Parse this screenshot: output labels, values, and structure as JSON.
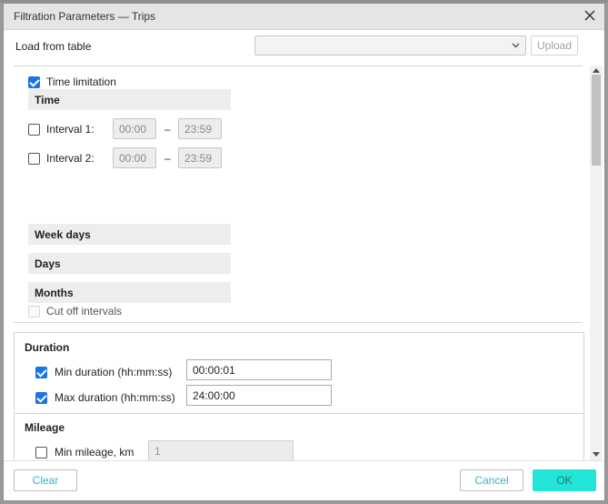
{
  "dialog": {
    "title": "Filtration Parameters — Trips",
    "close_icon": "close-icon"
  },
  "load": {
    "label": "Load from table",
    "select_value": "",
    "upload_label": "Upload"
  },
  "time_limitation": {
    "checkbox_label": "Time limitation",
    "checked": true,
    "time_header": "Time",
    "intervals": [
      {
        "label": "Interval 1:",
        "checked": false,
        "from": "00:00",
        "dash": "–",
        "to": "23:59"
      },
      {
        "label": "Interval 2:",
        "checked": false,
        "from": "00:00",
        "dash": "–",
        "to": "23:59"
      }
    ],
    "week_days_header": "Week days",
    "days_header": "Days",
    "months_header": "Months",
    "cut_off_label": "Cut off intervals",
    "cut_off_checked": false
  },
  "duration": {
    "title": "Duration",
    "min_label": "Min duration (hh:mm:ss)",
    "min_checked": true,
    "min_value": "00:00:01",
    "max_label": "Max duration (hh:mm:ss)",
    "max_checked": true,
    "max_value": "24:00:00"
  },
  "mileage": {
    "title": "Mileage",
    "min_label": "Min mileage, km",
    "min_checked": false,
    "min_value": "1"
  },
  "footer": {
    "clear_label": "Clear",
    "cancel_label": "Cancel",
    "ok_label": "OK"
  },
  "colors": {
    "accent": "#22e5d8",
    "link": "#2fb7c7",
    "checkbox": "#1a73e8"
  }
}
